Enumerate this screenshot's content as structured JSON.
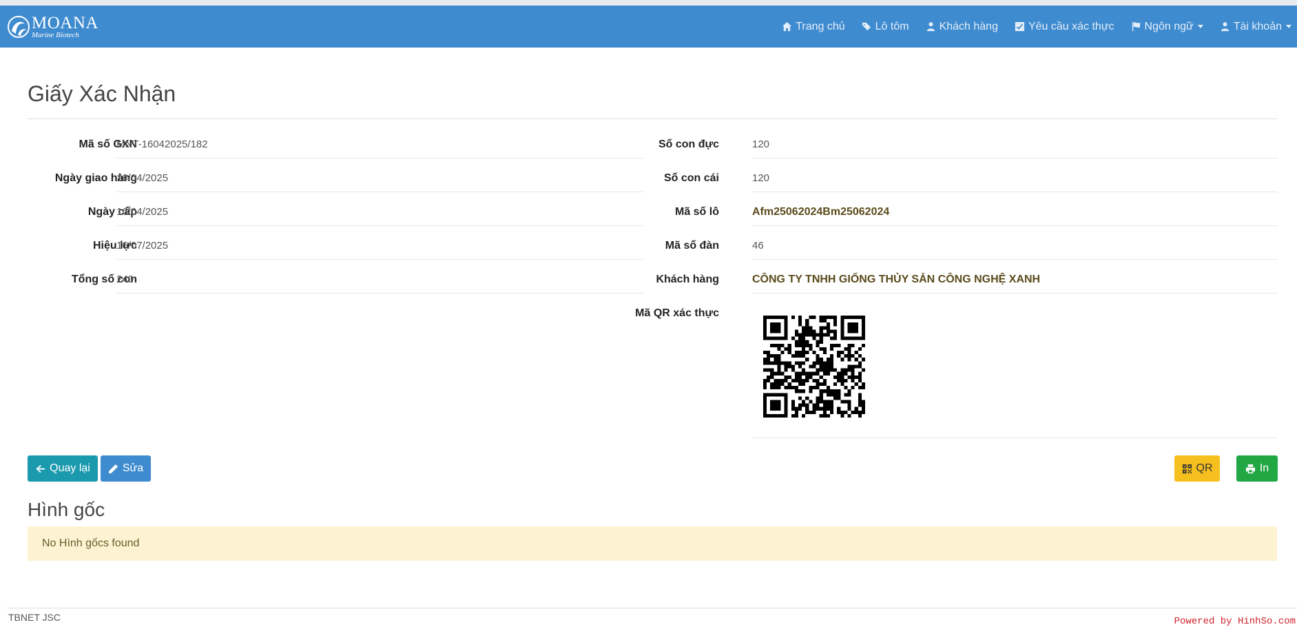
{
  "brand": {
    "name": "MOANA",
    "subtitle": "Marine Biotech"
  },
  "nav": {
    "home": "Trang chủ",
    "batches": "Lô tôm",
    "customers": "Khách hàng",
    "requests": "Yêu cầu xác thực",
    "language": "Ngôn ngữ",
    "account": "Tài khoản"
  },
  "page": {
    "title": "Giấy Xác Nhận"
  },
  "left_fields": [
    {
      "label": "Mã số GXN",
      "value": "MNT-16042025/182"
    },
    {
      "label": "Ngày giao hàng",
      "value": "16/04/2025"
    },
    {
      "label": "Ngày cấp",
      "value": "16/04/2025"
    },
    {
      "label": "Hiệu lực",
      "value": "16/07/2025"
    },
    {
      "label": "Tổng số con",
      "value": "240"
    }
  ],
  "right_fields": [
    {
      "label": "Số con đực",
      "value": "120"
    },
    {
      "label": "Số con cái",
      "value": "120"
    },
    {
      "label": "Mã số lô",
      "value": "Afm25062024Bm25062024"
    },
    {
      "label": "Mã số đàn",
      "value": "46"
    },
    {
      "label": "Khách hàng",
      "value": "CÔNG TY TNHH GIỐNG THỦY SẢN CÔNG NGHỆ XANH"
    },
    {
      "label": "Mã QR xác thực",
      "value": ""
    }
  ],
  "buttons": {
    "back": "Quay lại",
    "edit": "Sửa",
    "qr": "QR",
    "print": "In"
  },
  "originals": {
    "title": "Hình gốc",
    "empty": "No Hình gốcs found"
  },
  "footer": {
    "company": "TBNET JSC",
    "powered": "Powered by HinhSo.com"
  },
  "colors": {
    "navbar": "#3f8bcf",
    "back": "#1b9aad",
    "edit": "#3f8bcf",
    "qr": "#f5c01e",
    "print": "#22a745",
    "alert": "#fdf3d3"
  }
}
